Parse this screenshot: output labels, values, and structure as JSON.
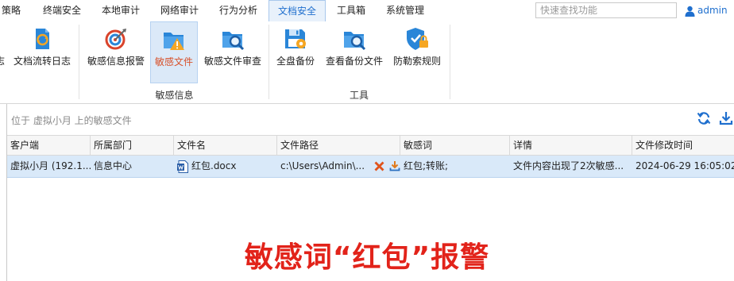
{
  "tabs": [
    {
      "label": "策略"
    },
    {
      "label": "终端安全"
    },
    {
      "label": "本地审计"
    },
    {
      "label": "网络审计"
    },
    {
      "label": "行为分析"
    },
    {
      "label": "文档安全"
    },
    {
      "label": "工具箱"
    },
    {
      "label": "系统管理"
    }
  ],
  "active_tab": "文档安全",
  "search": {
    "placeholder": "快速查找功能",
    "value": ""
  },
  "user": {
    "name": "admin"
  },
  "ribbon": {
    "partial_label": "志",
    "buttons": [
      {
        "label": "文档流转日志",
        "icon": "doc-flow-log-icon"
      },
      {
        "label": "敏感信息报警",
        "icon": "sensitive-alarm-icon"
      },
      {
        "label": "敏感文件",
        "icon": "sensitive-file-icon"
      },
      {
        "label": "敏感文件审查",
        "icon": "sensitive-file-review-icon"
      },
      {
        "label": "全盘备份",
        "icon": "full-backup-icon"
      },
      {
        "label": "查看备份文件",
        "icon": "view-backup-icon"
      },
      {
        "label": "防勒索规则",
        "icon": "anti-ransom-icon"
      }
    ],
    "groups": [
      {
        "label": "敏感信息"
      },
      {
        "label": "工具"
      }
    ]
  },
  "location": "位于 虚拟小月 上的敏感文件",
  "table": {
    "columns": [
      "客户端",
      "所属部门",
      "文件名",
      "文件路径",
      "敏感词",
      "详情",
      "文件修改时间"
    ],
    "rows": [
      {
        "client": "虚拟小月 (192.1...",
        "department": "信息中心",
        "filename": "红包.docx",
        "path": "c:\\Users\\Admin\\...",
        "keywords": "红包;转账;",
        "detail": "文件内容出现了2次敏感...",
        "modified": "2024-06-29 16:05:02"
      }
    ]
  },
  "overlay_text": "敏感词“红包”报警",
  "colors": {
    "accent": "#1f6fce",
    "active_tab_bg": "#e8f1fb",
    "selected_row": "#d9e9f9",
    "overlay": "#e2231a",
    "delete": "#e0531b",
    "download": "#e07a1b"
  }
}
